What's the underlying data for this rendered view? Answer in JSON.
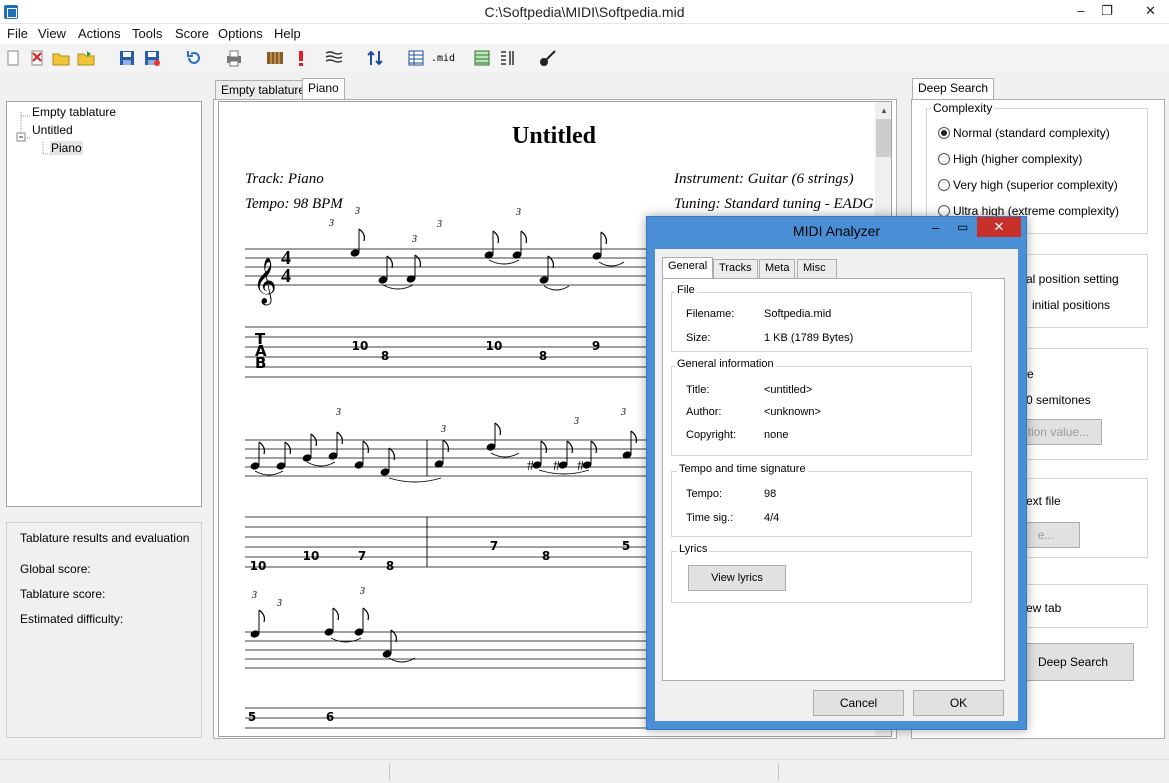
{
  "window": {
    "title": "C:\\Softpedia\\MIDI\\Softpedia.mid",
    "minimize": "–",
    "maximize": "❐",
    "close": "✕"
  },
  "menu": [
    "File",
    "View",
    "Actions",
    "Tools",
    "Score",
    "Options",
    "Help"
  ],
  "toolbar": {
    "mid_label": ".mid",
    "icons": [
      "new-icon",
      "delete-icon",
      "open-icon",
      "open-folder-icon",
      "save-icon",
      "save-as-icon",
      "refresh-icon",
      "print-icon",
      "guitar-fretboard-icon",
      "warning-icon",
      "staff-icon",
      "up-down-arrows-icon",
      "table-view-icon",
      "midi-file-icon",
      "grid-icon",
      "columns-icon",
      "guitar-icon"
    ]
  },
  "tree": {
    "items": [
      {
        "label": "Empty tablature"
      },
      {
        "label": "Untitled"
      },
      {
        "label": "Piano"
      }
    ]
  },
  "evaluation": {
    "title": "Tablature results and evaluation",
    "global_score": "Global score:",
    "tablature_score": "Tablature score:",
    "difficulty": "Estimated difficulty:"
  },
  "tabs": [
    {
      "label": "Empty tablature"
    },
    {
      "label": "Piano"
    }
  ],
  "score": {
    "title": "Untitled",
    "track": "Track: Piano",
    "tempo": "Tempo: 98 BPM",
    "instrument": "Instrument: Guitar (6 strings)",
    "tuning": "Tuning: Standard tuning - EADG",
    "tab_letters": [
      "T",
      "A",
      "B"
    ],
    "triplet": "3",
    "row1_tab": [
      {
        "fret": "10",
        "string": 2
      },
      {
        "fret": "8",
        "string": 3
      },
      {
        "fret": "10",
        "string": 2
      },
      {
        "fret": "8",
        "string": 3
      },
      {
        "fret": "9",
        "string": 2
      }
    ],
    "row2_tab": [
      {
        "fret": "10",
        "string": 5
      },
      {
        "fret": "10",
        "string": 4
      },
      {
        "fret": "7",
        "string": 4
      },
      {
        "fret": "8",
        "string": 5
      },
      {
        "fret": "7",
        "string": 3
      },
      {
        "fret": "8",
        "string": 4
      },
      {
        "fret": "5",
        "string": 3
      }
    ],
    "row3_tab": [
      {
        "fret": "5",
        "string": 1
      },
      {
        "fret": "6",
        "string": 1
      }
    ]
  },
  "deep_search": {
    "tab": "Deep Search",
    "complexity_label": "Complexity",
    "options": [
      {
        "label": "Normal (standard complexity)",
        "checked": true
      },
      {
        "label": "High (higher complexity)",
        "checked": false
      },
      {
        "label": "Very high (superior complexity)",
        "checked": false
      },
      {
        "label": "Ultra high (extreme complexity)",
        "checked": false
      }
    ],
    "position_setting": "al position setting",
    "initial_positions": "initial positions",
    "partial_e": "e",
    "semitones": "0 semitones",
    "position_value_btn": "ition value...",
    "text_file": "ext file",
    "ellipsis_btn": "e...",
    "view_tab": "ew tab",
    "deep_search_btn": "Deep Search"
  },
  "dialog": {
    "title": "MIDI Analyzer",
    "tabs": [
      "General",
      "Tracks",
      "Meta",
      "Misc"
    ],
    "file_group": "File",
    "filename_label": "Filename:",
    "filename": "Softpedia.mid",
    "size_label": "Size:",
    "size": "1 KB (1789 Bytes)",
    "general_group": "General information",
    "title_label": "Title:",
    "title_value": "<untitled>",
    "author_label": "Author:",
    "author_value": "<unknown>",
    "copyright_label": "Copyright:",
    "copyright_value": "none",
    "tempo_group": "Tempo and time signature",
    "tempo_label": "Tempo:",
    "tempo_value": "98",
    "timesig_label": "Time sig.:",
    "timesig_value": "4/4",
    "lyrics_group": "Lyrics",
    "view_lyrics": "View lyrics",
    "cancel": "Cancel",
    "ok": "OK"
  }
}
